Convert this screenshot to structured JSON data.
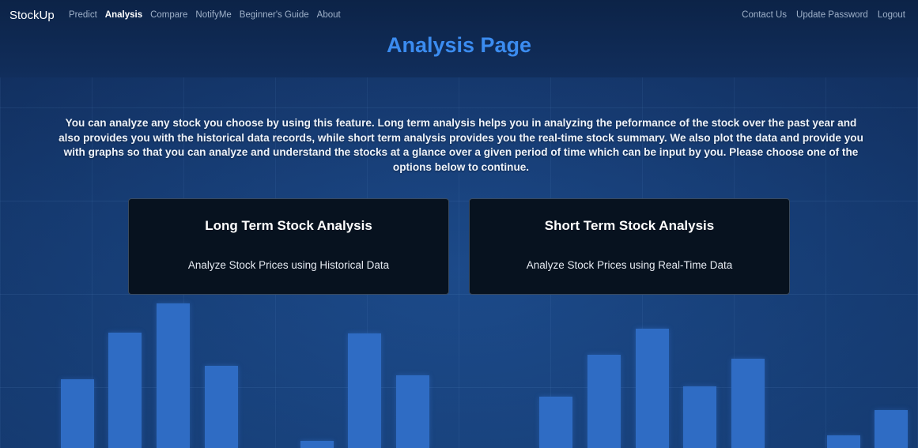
{
  "navbar": {
    "brand": "StockUp",
    "left_links": [
      {
        "label": "Predict",
        "active": false
      },
      {
        "label": "Analysis",
        "active": true
      },
      {
        "label": "Compare",
        "active": false
      },
      {
        "label": "NotifyMe",
        "active": false
      },
      {
        "label": "Beginner's Guide",
        "active": false
      },
      {
        "label": "About",
        "active": false
      }
    ],
    "right_links": [
      {
        "label": "Contact Us"
      },
      {
        "label": "Update Password"
      },
      {
        "label": "Logout"
      }
    ]
  },
  "page": {
    "title": "Analysis Page",
    "intro": "You can analyze any stock you choose by using this feature. Long term analysis helps you in analyzing the peformance of the stock over the past year and also provides you with the historical data records, while short term analysis provides you the real-time stock summary. We also plot the data and provide you with graphs so that you can analyze and understand the stocks at a glance over a given period of time which can be input by you. Please choose one of the options below to continue."
  },
  "cards": {
    "long": {
      "title": "Long Term Stock Analysis",
      "text": "Analyze Stock Prices using Historical Data"
    },
    "short": {
      "title": "Short Term Stock Analysis",
      "text": "Analyze Stock Prices using Real-Time Data"
    }
  },
  "colors": {
    "title_accent": "#3b8cf0",
    "card_background": "#07121f",
    "bar_color": "#2f6cc4"
  }
}
